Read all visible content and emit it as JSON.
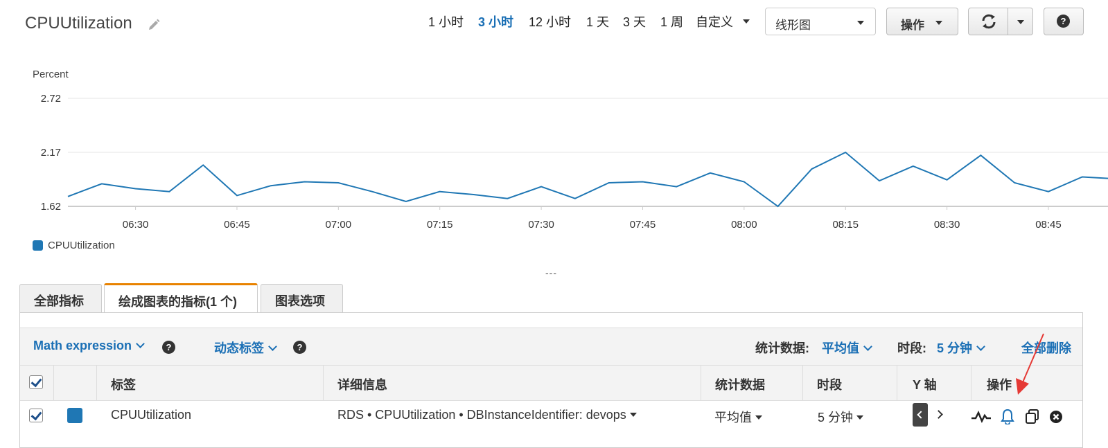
{
  "header": {
    "title": "CPUUtilization",
    "ranges": [
      "1 小时",
      "3 小时",
      "12 小时",
      "1 天",
      "3 天",
      "1 周"
    ],
    "active_range": "3 小时",
    "custom_label": "自定义",
    "chart_type_select": "线形图",
    "actions_label": "操作",
    "help_glyph": "?"
  },
  "chart_data": {
    "type": "line",
    "ylabel": "Percent",
    "y_ticks": [
      "2.72",
      "2.17",
      "1.62"
    ],
    "ylim": [
      1.62,
      2.72
    ],
    "x_ticks": [
      "06:30",
      "06:45",
      "07:00",
      "07:15",
      "07:30",
      "07:45",
      "08:00",
      "08:15",
      "08:30",
      "08:45"
    ],
    "x_start_min": 380,
    "x_end_min": 529,
    "series": [
      {
        "name": "CPUUtilization",
        "color": "#1f77b4",
        "points": [
          [
            "06:20",
            1.72
          ],
          [
            "06:25",
            1.85
          ],
          [
            "06:30",
            1.8
          ],
          [
            "06:35",
            1.77
          ],
          [
            "06:40",
            2.04
          ],
          [
            "06:45",
            1.73
          ],
          [
            "06:50",
            1.83
          ],
          [
            "06:55",
            1.87
          ],
          [
            "07:00",
            1.86
          ],
          [
            "07:05",
            1.77
          ],
          [
            "07:10",
            1.67
          ],
          [
            "07:15",
            1.77
          ],
          [
            "07:20",
            1.74
          ],
          [
            "07:25",
            1.7
          ],
          [
            "07:30",
            1.82
          ],
          [
            "07:35",
            1.7
          ],
          [
            "07:40",
            1.86
          ],
          [
            "07:45",
            1.87
          ],
          [
            "07:50",
            1.82
          ],
          [
            "07:55",
            1.96
          ],
          [
            "08:00",
            1.87
          ],
          [
            "08:05",
            1.62
          ],
          [
            "08:10",
            2.0
          ],
          [
            "08:15",
            2.17
          ],
          [
            "08:20",
            1.88
          ],
          [
            "08:25",
            2.03
          ],
          [
            "08:30",
            1.89
          ],
          [
            "08:35",
            2.14
          ],
          [
            "08:40",
            1.86
          ],
          [
            "08:45",
            1.77
          ],
          [
            "08:50",
            1.92
          ],
          [
            "08:55",
            1.9
          ]
        ]
      }
    ]
  },
  "legend": {
    "label": "CPUUtilization",
    "color": "#1f77b4"
  },
  "resize_handle": "---",
  "tabs": [
    "全部指标",
    "绘成图表的指标(1 个)",
    "图表选项"
  ],
  "toolbar": {
    "math_expression": "Math expression",
    "dynamic_labels": "动态标签",
    "stat_label": "统计数据:",
    "stat_value": "平均值",
    "period_label": "时段:",
    "period_value": "5 分钟",
    "delete_all": "全部删除"
  },
  "table": {
    "headers": [
      "标签",
      "详细信息",
      "统计数据",
      "时段",
      "Y 轴",
      "操作"
    ],
    "row": {
      "label": "CPUUtilization",
      "details": "RDS • CPUUtilization • DBInstanceIdentifier: devops",
      "stat": "平均值",
      "period": "5 分钟"
    }
  }
}
